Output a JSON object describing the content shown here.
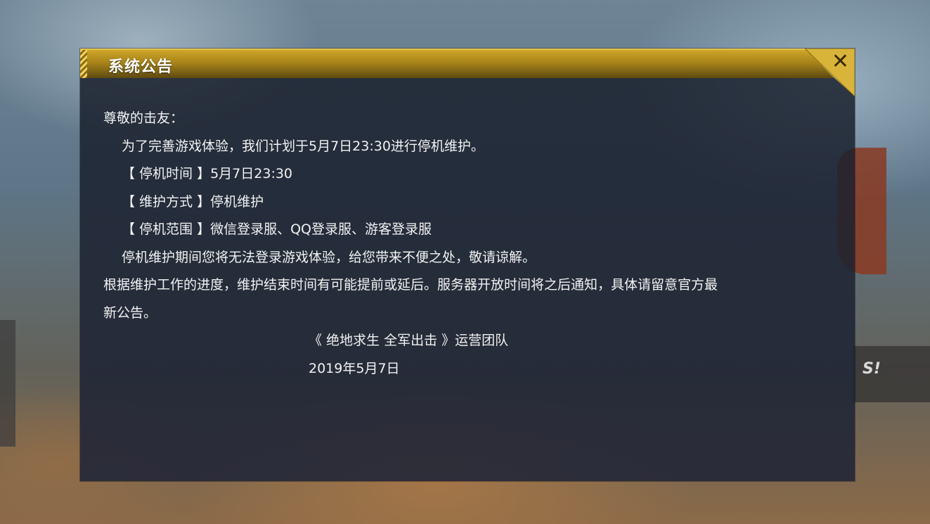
{
  "dialog": {
    "title": "系统公告",
    "close_icon": "close-icon",
    "greeting": "尊敬的击友：",
    "intro": "为了完善游戏体验，我们计划于5月7日23:30进行停机维护。",
    "details": [
      {
        "key": "【 停机时间 】",
        "value": "5月7日23:30"
      },
      {
        "key": "【 维护方式 】",
        "value": "停机维护"
      },
      {
        "key": "【 停机范围 】",
        "value": "微信登录服、QQ登录服、游客登录服"
      }
    ],
    "apology": "停机维护期间您将无法登录游戏体验，给您带来不便之处，敬请谅解。",
    "note_line1": "根据维护工作的进度，维护结束时间有可能提前或延后。服务器开放时间将之后通知，具体请留意官方最",
    "note_line2": "新公告。",
    "signature_team": "《 绝地求生 全军出击 》运营团队",
    "signature_date": "2019年5月7日"
  },
  "background": {
    "sign_text": "S!"
  },
  "colors": {
    "title_gold": "#cfa52a",
    "panel_bg": "#1c2230",
    "text": "#f2f2f2"
  }
}
